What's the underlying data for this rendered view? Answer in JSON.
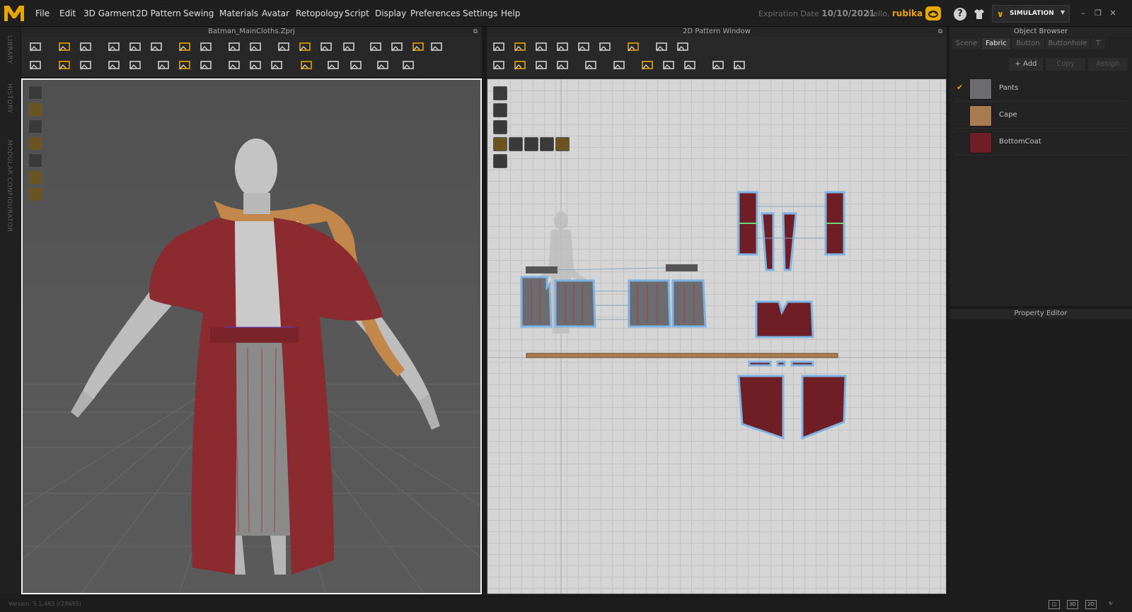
{
  "menu": [
    "File",
    "Edit",
    "3D Garment",
    "2D Pattern",
    "Sewing",
    "Materials",
    "Avatar",
    "Retopology",
    "Script",
    "Display",
    "Preferences",
    "Settings",
    "Help"
  ],
  "expiration": {
    "label": "Expiration Date",
    "date": "10/10/2021"
  },
  "user": {
    "greeting": "Hello,",
    "name": "rubika"
  },
  "mode": "SIMULATION",
  "left_strip": [
    "LIBRARY",
    "HISTORY",
    "MODULAR CONFIGURATOR"
  ],
  "viewport3d": {
    "title": "Batman_MainCloths.Zprj"
  },
  "viewport2d": {
    "title": "2D Pattern Window"
  },
  "object_browser": {
    "title": "Object Browser",
    "tabs": [
      "Scene",
      "Fabric",
      "Button",
      "Buttonhole",
      "T"
    ],
    "active_tab": "Fabric",
    "actions": [
      "+ Add",
      "Copy",
      "Assign"
    ],
    "fabrics": [
      {
        "name": "Pants",
        "color": "#6b6b70",
        "selected": true
      },
      {
        "name": "Cape",
        "color": "#a87b50",
        "selected": false
      },
      {
        "name": "BottomCoat",
        "color": "#6e1e24",
        "selected": false
      }
    ]
  },
  "property_editor": {
    "title": "Property Editor"
  },
  "status": {
    "version": "Version: 5.1.463 (r28695)"
  },
  "colors": {
    "accent": "#e7a600",
    "coat": "#8b2a2f",
    "cape": "#c2874a",
    "pattern_outline": "#7fb2e0"
  }
}
